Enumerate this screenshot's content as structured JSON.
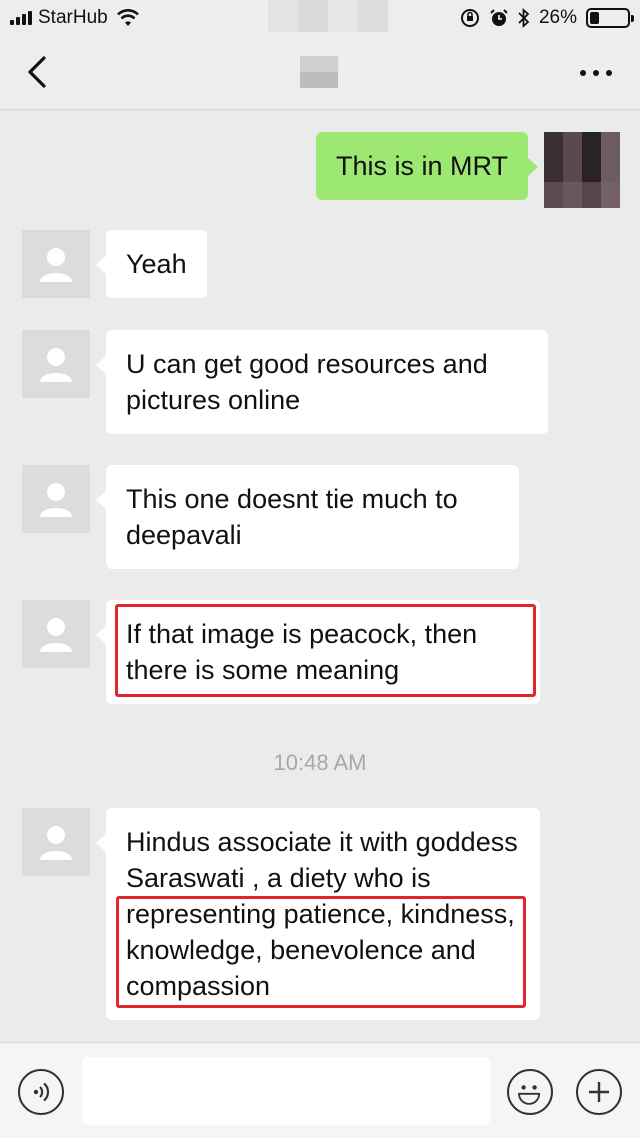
{
  "status_bar": {
    "carrier": "StarHub",
    "battery": "26%",
    "battery_level": 0.26
  },
  "conversation": {
    "title": ""
  },
  "messages": [
    {
      "from": "me",
      "text": "This is in MRT"
    },
    {
      "from": "them",
      "text": "Yeah"
    },
    {
      "from": "them",
      "text": "U can get good resources and pictures online"
    },
    {
      "from": "them",
      "text": "This one doesnt tie much to deepavali"
    },
    {
      "from": "them",
      "text": "If that image is peacock, then there is some meaning"
    },
    {
      "from": "them",
      "text": "Hindus associate it with goddess Saraswati , a diety who is representing patience, kindness, knowledge, benevolence and compassion"
    }
  ],
  "timestamp": "10:48 AM",
  "input": {
    "value": "",
    "placeholder": ""
  },
  "colors": {
    "outgoing_bubble": "#9de872",
    "incoming_bubble": "#ffffff",
    "highlight": "#e0262b",
    "background": "#ebebeb"
  },
  "icons": [
    "back-chevron-icon",
    "more-dots-icon",
    "voice-icon",
    "emoji-icon",
    "plus-icon",
    "default-avatar-icon"
  ]
}
